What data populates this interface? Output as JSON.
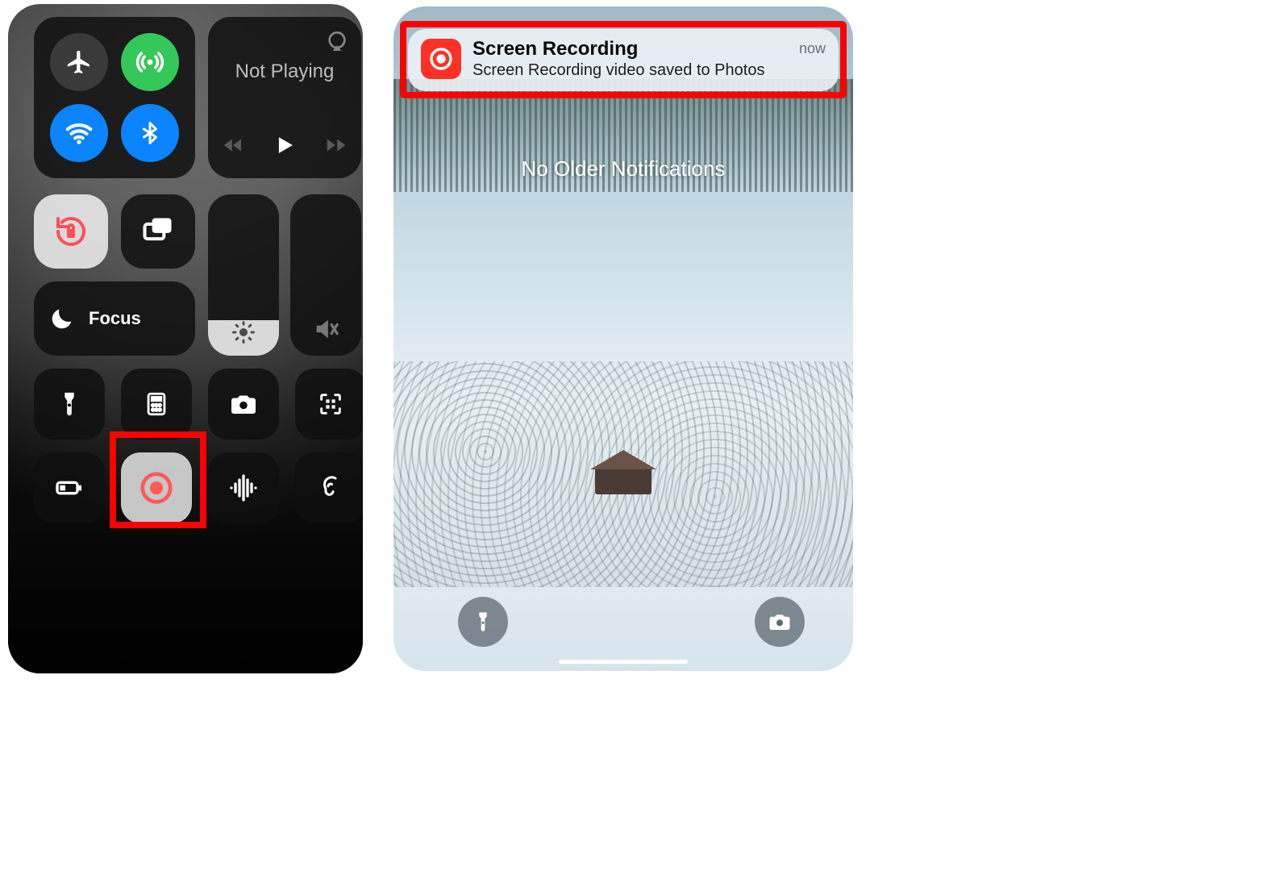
{
  "control_center": {
    "connectivity": {
      "airplane": {
        "icon": "airplane-icon",
        "active": false,
        "color_off": "#3a3a3a"
      },
      "cellular": {
        "icon": "cellular-icon",
        "active": true,
        "color_on": "#34c759"
      },
      "wifi": {
        "icon": "wifi-icon",
        "active": true,
        "color_on": "#0a84ff"
      },
      "bluetooth": {
        "icon": "bluetooth-icon",
        "active": true,
        "color_on": "#0a84ff"
      }
    },
    "media": {
      "airplay_icon": "airplay-icon",
      "now_playing_label": "Not Playing",
      "transport": {
        "back": "rewind-icon",
        "play": "play-icon",
        "fwd": "fastforward-icon"
      }
    },
    "rotation_lock": {
      "icon": "rotation-lock-icon",
      "active": true
    },
    "screen_mirroring": {
      "icon": "screen-mirroring-icon"
    },
    "focus": {
      "icon": "moon-icon",
      "label": "Focus"
    },
    "brightness": {
      "icon": "sun-icon",
      "percent": 22
    },
    "volume": {
      "icon": "speaker-mute-icon",
      "percent": 0
    },
    "tiles_row1": [
      {
        "name": "flashlight-tile",
        "icon": "flashlight-icon"
      },
      {
        "name": "calculator-tile",
        "icon": "calculator-icon"
      },
      {
        "name": "camera-tile",
        "icon": "camera-icon"
      },
      {
        "name": "qr-scan-tile",
        "icon": "qr-icon"
      }
    ],
    "tiles_row2": [
      {
        "name": "low-power-tile",
        "icon": "battery-icon"
      },
      {
        "name": "screen-record-tile",
        "icon": "record-icon",
        "highlighted": true,
        "active_bg": true
      },
      {
        "name": "sound-recognition-tile",
        "icon": "waveform-icon"
      },
      {
        "name": "hearing-tile",
        "icon": "ear-icon"
      }
    ],
    "highlight_color": "#ff0000"
  },
  "lock_screen": {
    "notification": {
      "app_icon": "record-icon",
      "accent": "#ff3026",
      "title": "Screen Recording",
      "body": "Screen Recording video saved to Photos",
      "when": "now",
      "highlighted": true
    },
    "center_text": "No Older Notifications",
    "fab_left": {
      "name": "flashlight-fab",
      "icon": "flashlight-icon"
    },
    "fab_right": {
      "name": "camera-fab",
      "icon": "camera-fill-icon"
    }
  }
}
